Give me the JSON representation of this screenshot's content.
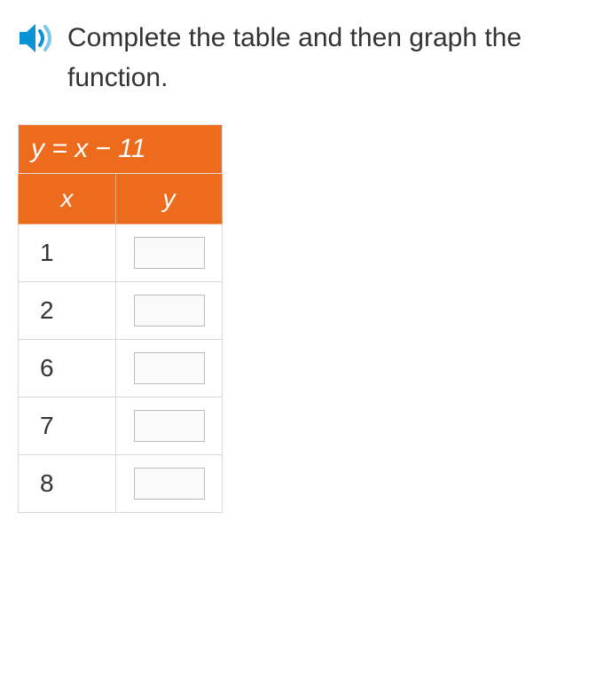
{
  "question": {
    "text": "Complete the table and then graph the function."
  },
  "table": {
    "equation": "y = x − 11",
    "x_label": "x",
    "y_label": "y",
    "rows": [
      {
        "x": "1",
        "y": ""
      },
      {
        "x": "2",
        "y": ""
      },
      {
        "x": "6",
        "y": ""
      },
      {
        "x": "7",
        "y": ""
      },
      {
        "x": "8",
        "y": ""
      }
    ]
  },
  "chart_data": {
    "type": "table",
    "title": "y = x − 11",
    "columns": [
      "x",
      "y"
    ],
    "rows": [
      [
        1,
        null
      ],
      [
        2,
        null
      ],
      [
        6,
        null
      ],
      [
        7,
        null
      ],
      [
        8,
        null
      ]
    ]
  }
}
